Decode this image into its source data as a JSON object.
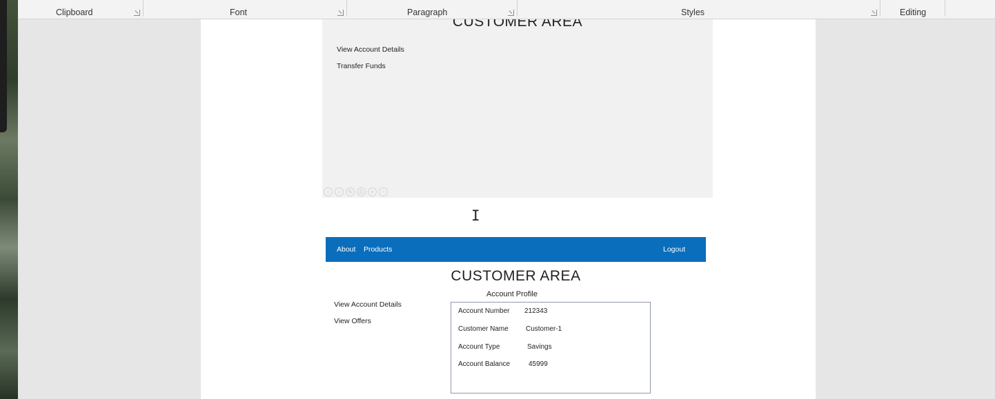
{
  "ribbon": {
    "groups": [
      "Clipboard",
      "Font",
      "Paragraph",
      "Styles",
      "Editing"
    ]
  },
  "mockup_top": {
    "heading": "CUSTOMER  AREA",
    "links": [
      "View Account Details",
      "Transfer Funds"
    ]
  },
  "mockup_bottom": {
    "nav": {
      "about": "About",
      "products": "Products",
      "logout": "Logout"
    },
    "heading": "CUSTOMER  AREA",
    "links": [
      "View Account Details",
      "View Offers"
    ],
    "profile": {
      "title": "Account Profile",
      "rows": [
        {
          "label": "Account Number",
          "value": "212343"
        },
        {
          "label": "Customer Name",
          "value": "Customer-1"
        },
        {
          "label": "Account Type",
          "value": "Savings"
        },
        {
          "label": "Account Balance",
          "value": "45999"
        }
      ]
    }
  },
  "colors": {
    "navbar": "#0a6ebd",
    "mock_background": "#f1f1f1",
    "canvas": "#e6e6e6"
  }
}
